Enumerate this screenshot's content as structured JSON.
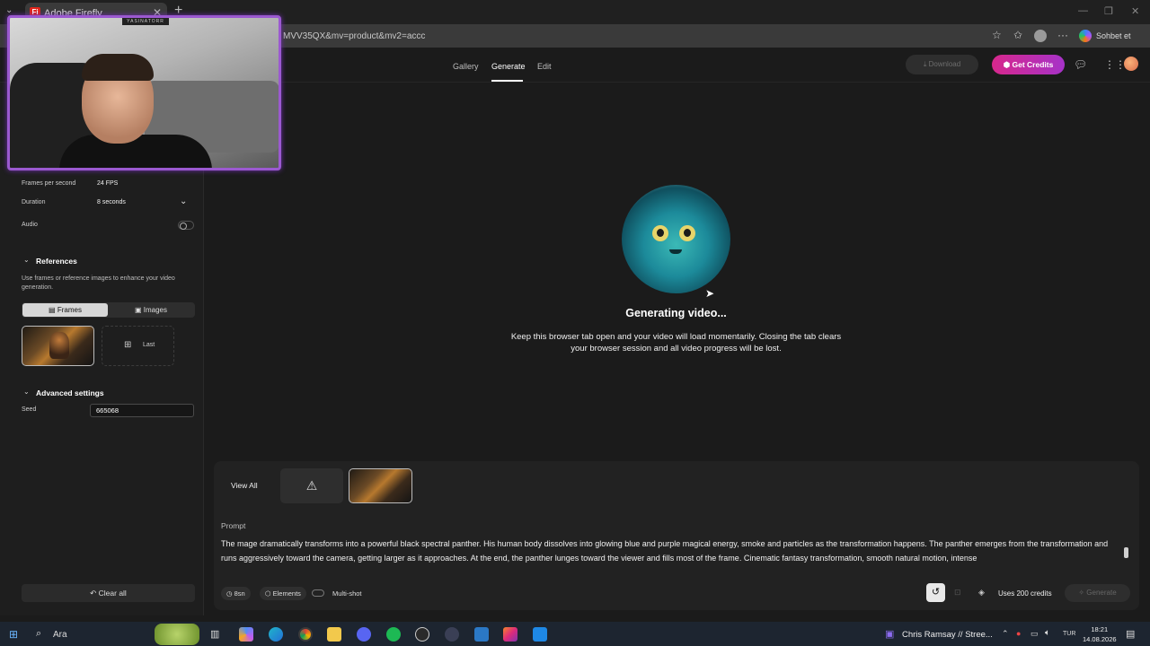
{
  "browser": {
    "tab_title": "Adobe Firefly",
    "tab_favicon": "Fi",
    "url": "MVV35QX&mv=product&mv2=accc",
    "copilot_label": "Sohbet et"
  },
  "header": {
    "nav": [
      "Gallery",
      "Generate",
      "Edit"
    ],
    "active_nav": "Generate",
    "download_label": "Download",
    "get_credits_label": "Get Credits"
  },
  "settings": {
    "fps_label": "Frames per second",
    "fps_value": "24 FPS",
    "duration_label": "Duration",
    "duration_value": "8 seconds",
    "audio_label": "Audio",
    "audio_on": false
  },
  "references": {
    "title": "References",
    "description": "Use frames or reference images to enhance your video generation.",
    "segment_frames": "Frames",
    "segment_images": "Images",
    "active_segment": "Frames",
    "last_label": "Last"
  },
  "advanced": {
    "title": "Advanced settings",
    "seed_label": "Seed",
    "seed_value": "665068"
  },
  "left_footer": {
    "clear_all_label": "Clear all"
  },
  "webcam": {
    "tag": "YASINATORR"
  },
  "main": {
    "status_title": "Generating video...",
    "status_message": "Keep this browser tab open and your video will load momentarily. Closing the tab clears your browser session and all video progress will be lost."
  },
  "bottom": {
    "view_all_label": "View All",
    "prompt_label": "Prompt",
    "prompt_text": "The mage dramatically transforms into a powerful black spectral panther. His human body dissolves into glowing blue and purple magical energy, smoke and particles as the transformation happens. The panther emerges from the transformation and runs aggressively toward the camera, getting larger as it approaches. At the end, the panther lunges toward the viewer and fills most of the frame. Cinematic fantasy transformation, smooth natural motion, intense",
    "duration_pill": "8sn",
    "elements_pill": "Elements",
    "multishot_label": "Multi-shot",
    "credits_text": "Uses 200 credits",
    "generate_label": "Generate"
  },
  "taskbar": {
    "search_label": "Ara",
    "media_label": "Chris Ramsay // Stree...",
    "language": "TUR",
    "time": "18:21",
    "date": "14.08.2026"
  },
  "colors": {
    "accent_gradient_start": "#d7288c",
    "accent_gradient_end": "#a632c8",
    "webcam_border": "#9b59d0"
  }
}
